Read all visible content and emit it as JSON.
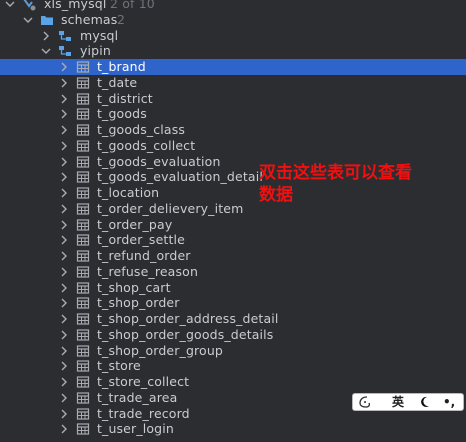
{
  "tree": {
    "root": {
      "label": "xls_mysql",
      "count": "2 of 10"
    },
    "schemas": {
      "label": "schemas",
      "count": "2"
    },
    "db_mysql": {
      "label": "mysql"
    },
    "db_yipin": {
      "label": "yipin"
    },
    "tables": [
      "t_brand",
      "t_date",
      "t_district",
      "t_goods",
      "t_goods_class",
      "t_goods_collect",
      "t_goods_evaluation",
      "t_goods_evaluation_detail",
      "t_location",
      "t_order_delievery_item",
      "t_order_pay",
      "t_order_settle",
      "t_refund_order",
      "t_refuse_reason",
      "t_shop_cart",
      "t_shop_order",
      "t_shop_order_address_detail",
      "t_shop_order_goods_details",
      "t_shop_order_group",
      "t_store",
      "t_store_collect",
      "t_trade_area",
      "t_trade_record",
      "t_user_login"
    ],
    "selected_index": 0
  },
  "annotation": {
    "line1": "双击这些表可以查看",
    "line2": "数据"
  },
  "ime": {
    "mode": "英",
    "punct": "•,"
  },
  "colors": {
    "background": "#2b2d30",
    "selection": "#2f65ca",
    "annotation": "#f01010",
    "folder": "#59a3e8",
    "table_icon": "#a7abb2"
  }
}
